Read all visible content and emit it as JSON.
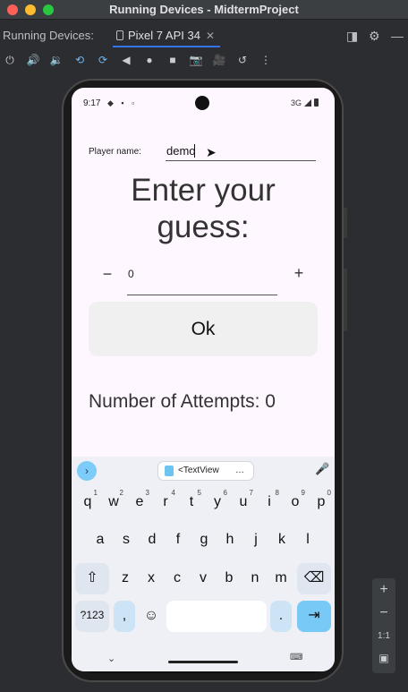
{
  "window": {
    "title": "Running Devices - MidtermProject"
  },
  "tool_window": {
    "label": "Running Devices:",
    "device_tab": "Pixel 7 API 34"
  },
  "toolbar": {
    "icons": [
      "power-icon",
      "volume-up-icon",
      "volume-down-icon",
      "rotate-left-icon",
      "rotate-right-icon",
      "back-icon",
      "home-icon",
      "overview-icon",
      "screenshot-icon",
      "screen-record-icon",
      "snapshot-icon",
      "more-options-icon"
    ]
  },
  "status_bar": {
    "time": "9:17",
    "network": "3G"
  },
  "app": {
    "player_label": "Player name:",
    "player_value": "demo",
    "heading_line1": "Enter your",
    "heading_line2": "guess:",
    "minus": "−",
    "guess_value": "0",
    "plus": "+",
    "ok_label": "Ok",
    "attempts": "Number of Attempts: 0"
  },
  "keyboard": {
    "clipboard_chip": "<TextView",
    "clipboard_more": "…",
    "row1": [
      {
        "k": "q",
        "s": "1"
      },
      {
        "k": "w",
        "s": "2"
      },
      {
        "k": "e",
        "s": "3"
      },
      {
        "k": "r",
        "s": "4"
      },
      {
        "k": "t",
        "s": "5"
      },
      {
        "k": "y",
        "s": "6"
      },
      {
        "k": "u",
        "s": "7"
      },
      {
        "k": "i",
        "s": "8"
      },
      {
        "k": "o",
        "s": "9"
      },
      {
        "k": "p",
        "s": "0"
      }
    ],
    "row2": [
      "a",
      "s",
      "d",
      "f",
      "g",
      "h",
      "j",
      "k",
      "l"
    ],
    "row3": [
      "z",
      "x",
      "c",
      "v",
      "b",
      "n",
      "m"
    ],
    "sym_label": "?123",
    "comma": ",",
    "period": "."
  },
  "zoom_panel": {
    "plus": "+",
    "minus": "−",
    "actual": "1:1"
  },
  "colors": {
    "accent": "#3574f0",
    "screen_bg": "#fef7ff",
    "keyboard_blue": "#79c9f6"
  }
}
